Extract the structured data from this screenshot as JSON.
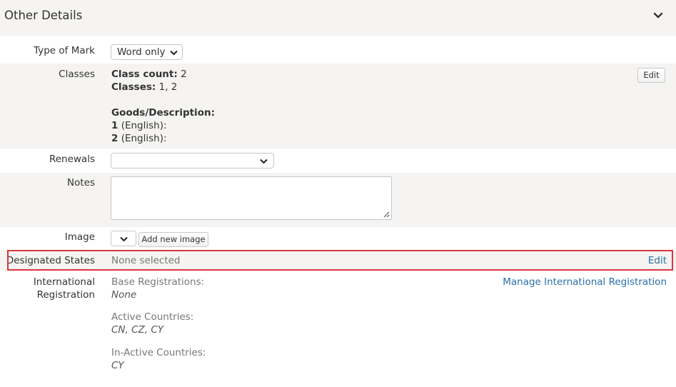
{
  "section": {
    "title": "Other Details"
  },
  "type_of_mark": {
    "label": "Type of Mark",
    "value": "Word only"
  },
  "classes": {
    "label": "Classes",
    "count_label": "Class count:",
    "count_value": "2",
    "classes_label": "Classes:",
    "classes_value": "1, 2",
    "goods_label": "Goods/Description:",
    "goods": [
      {
        "num": "1",
        "lang": "(English):"
      },
      {
        "num": "2",
        "lang": "(English):"
      }
    ],
    "edit_label": "Edit"
  },
  "renewals": {
    "label": "Renewals",
    "value": ""
  },
  "notes": {
    "label": "Notes",
    "value": ""
  },
  "image": {
    "label": "Image",
    "add_label": "Add new image"
  },
  "designated_states": {
    "label": "Designated States",
    "value": "None selected",
    "edit_label": "Edit",
    "highlight_color": "#d9363e"
  },
  "international": {
    "label_line1": "International",
    "label_line2": "Registration",
    "manage_label": "Manage International Registration",
    "base_label": "Base Registrations:",
    "base_value": "None",
    "active_label": "Active Countries:",
    "active_value": "CN, CZ, CY",
    "inactive_label": "In-Active Countries:",
    "inactive_value": "CY"
  }
}
